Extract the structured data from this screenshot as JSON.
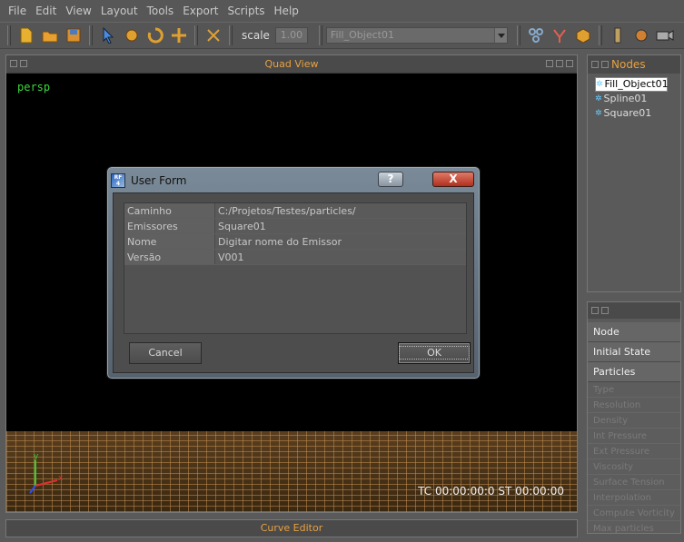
{
  "menu": [
    "File",
    "Edit",
    "View",
    "Layout",
    "Tools",
    "Export",
    "Scripts",
    "Help"
  ],
  "toolbar": {
    "scale_label": "scale",
    "scale_value": "1.00",
    "object_select": "Fill_Object01"
  },
  "quad_view": {
    "title": "Quad View",
    "camera": "persp",
    "timecode": "TC 00:00:00:0    ST 00:00:00"
  },
  "nodes_panel": {
    "title": "Nodes",
    "items": [
      "Fill_Object01",
      "Spline01",
      "Square01"
    ],
    "selected": "Fill_Object01"
  },
  "properties": {
    "sections": [
      "Node",
      "Initial State",
      "Particles"
    ],
    "params": [
      "Type",
      "Resolution",
      "Density",
      "Int Pressure",
      "Ext Pressure",
      "Viscosity",
      "Surface Tension",
      "Interpolation",
      "Compute Vorticity",
      "Max particles"
    ]
  },
  "curve_editor": {
    "title": "Curve Editor"
  },
  "dialog": {
    "title": "User Form",
    "help_label": "?",
    "close_label": "X",
    "rows": [
      {
        "key": "Caminho",
        "value": "C:/Projetos/Testes/particles/"
      },
      {
        "key": "Emissores",
        "value": "Square01"
      },
      {
        "key": "Nome",
        "value": "Digitar nome do Emissor"
      },
      {
        "key": "Versão",
        "value": "V001"
      }
    ],
    "cancel_label": "Cancel",
    "ok_label": "OK"
  },
  "colors": {
    "panel_title": "#e8a040",
    "persp": "#3cd63c"
  },
  "icons": [
    "new-file-icon",
    "open-folder-icon",
    "save-icon",
    "select-arrow-icon",
    "move-icon",
    "rotate-icon",
    "scale-icon",
    "node-tool-icon",
    "link-icon",
    "fork-icon",
    "cube-icon",
    "daemon-icon",
    "emitter-icon",
    "camera-icon"
  ]
}
